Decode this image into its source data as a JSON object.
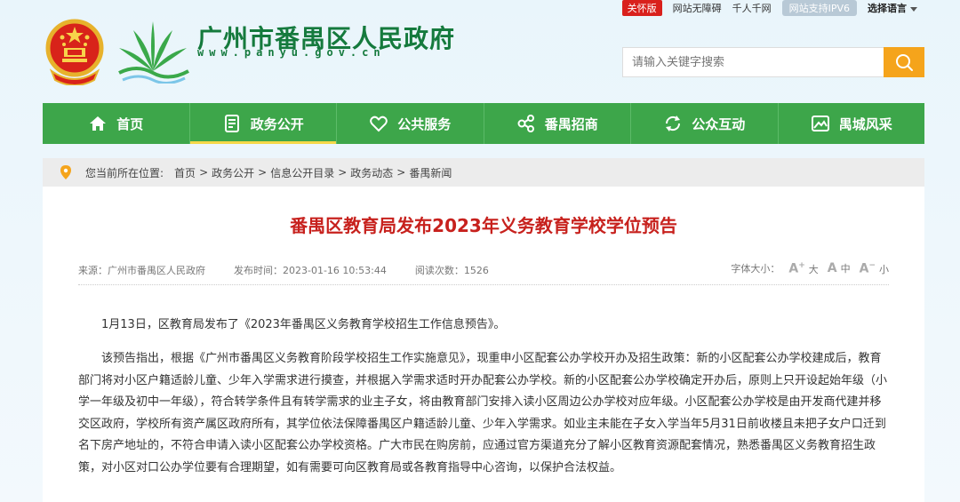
{
  "topbar": {
    "care_label": "关怀版",
    "accessible_label": "网站无障碍",
    "portal_label": "千人千网",
    "ipv6_label": "网站支持IPV6",
    "lang_label": "选择语言"
  },
  "header": {
    "title": "广州市番禺区人民政府",
    "url": "www.panyu.gov.cn"
  },
  "search": {
    "placeholder": "请输入关键字搜索"
  },
  "nav": {
    "items": [
      {
        "label": "首页",
        "icon": "home-icon"
      },
      {
        "label": "政务公开",
        "icon": "document-icon"
      },
      {
        "label": "公共服务",
        "icon": "heart-icon"
      },
      {
        "label": "番禺招商",
        "icon": "network-icon"
      },
      {
        "label": "公众互动",
        "icon": "refresh-icon"
      },
      {
        "label": "禺城风采",
        "icon": "image-icon"
      }
    ],
    "active_index": 1
  },
  "breadcrumb": {
    "prefix": "您当前所在位置:",
    "items": [
      "首页",
      "政务公开",
      "信息公开目录",
      "政务动态",
      "番禺新闻"
    ]
  },
  "article": {
    "title": "番禺区教育局发布2023年义务教育学校学位预告",
    "source": "来源：广州市番禺区人民政府",
    "published": "发布时间：2023-01-16 10:53:44",
    "views": "阅读次数：1526",
    "fontsize_label": "字体大小：",
    "fontsize_large": "大",
    "fontsize_medium": "中",
    "fontsize_small": "小",
    "paragraphs": [
      "1月13日，区教育局发布了《2023年番禺区义务教育学校招生工作信息预告》。",
      "该预告指出，根据《广州市番禺区义务教育阶段学校招生工作实施意见》，现重申小区配套公办学校开办及招生政策：新的小区配套公办学校建成后，教育部门将对小区户籍适龄儿童、少年入学需求进行摸查，并根据入学需求适时开办配套公办学校。新的小区配套公办学校确定开办后，原则上只开设起始年级（小学一年级及初中一年级），符合转学条件且有转学需求的业主子女，将由教育部门安排入读小区周边公办学校对应年级。小区配套公办学校是由开发商代建并移交区政府，学校所有资产属区政府所有，其学位依法保障番禺区户籍适龄儿童、少年入学需求。如业主未能在子女入学当年5月31日前收楼且未把子女户口迁到名下房产地址的，不符合申请入读小区配套公办学校资格。广大市民在购房前，应通过官方渠道充分了解小区教育资源配套情况，熟悉番禺区义务教育招生政策，对小区对口公办学位要有合理期望，如有需要可向区教育局或各教育指导中心咨询，以保护合法权益。"
    ]
  },
  "colors": {
    "nav_green": "#3da64a",
    "title_red": "#c7211d",
    "brand_green": "#157a3d",
    "search_orange": "#f5a41b",
    "care_red": "#d9201c"
  }
}
